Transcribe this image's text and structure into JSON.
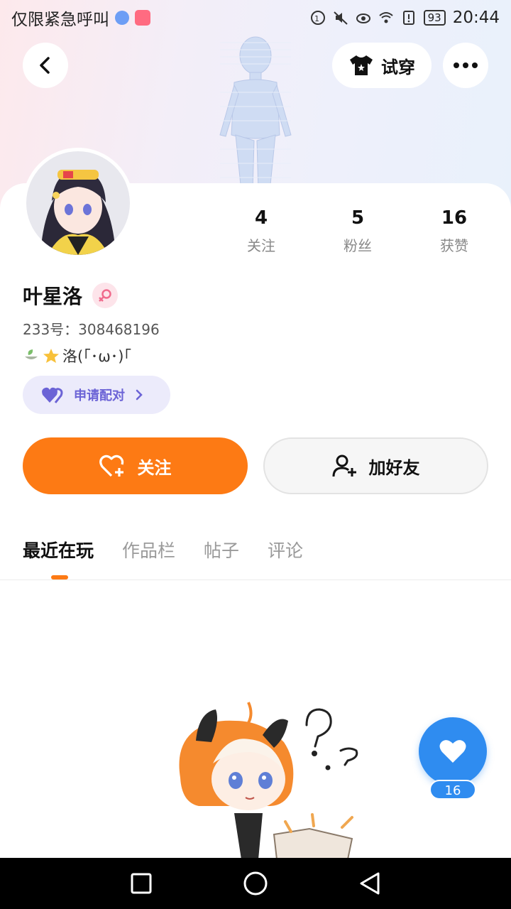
{
  "status_bar": {
    "carrier": "仅限紧急呼叫",
    "battery": "93",
    "time": "20:44"
  },
  "header": {
    "try_on_label": "试穿"
  },
  "profile": {
    "name": "叶星洛",
    "uid": "233号：308468196",
    "bio": "洛(｢･ω･)｢",
    "pair_label": "申请配对"
  },
  "stats": [
    {
      "value": "4",
      "label": "关注"
    },
    {
      "value": "5",
      "label": "粉丝"
    },
    {
      "value": "16",
      "label": "获赞"
    }
  ],
  "actions": {
    "follow_label": "关注",
    "add_friend_label": "加好友"
  },
  "tabs": [
    {
      "label": "最近在玩",
      "active": true
    },
    {
      "label": "作品栏",
      "active": false
    },
    {
      "label": "帖子",
      "active": false
    },
    {
      "label": "评论",
      "active": false
    }
  ],
  "like": {
    "count": "16"
  },
  "colors": {
    "accent_orange": "#fd7a14",
    "like_blue": "#2f8cf0",
    "pair_purple": "#6b63d6"
  }
}
